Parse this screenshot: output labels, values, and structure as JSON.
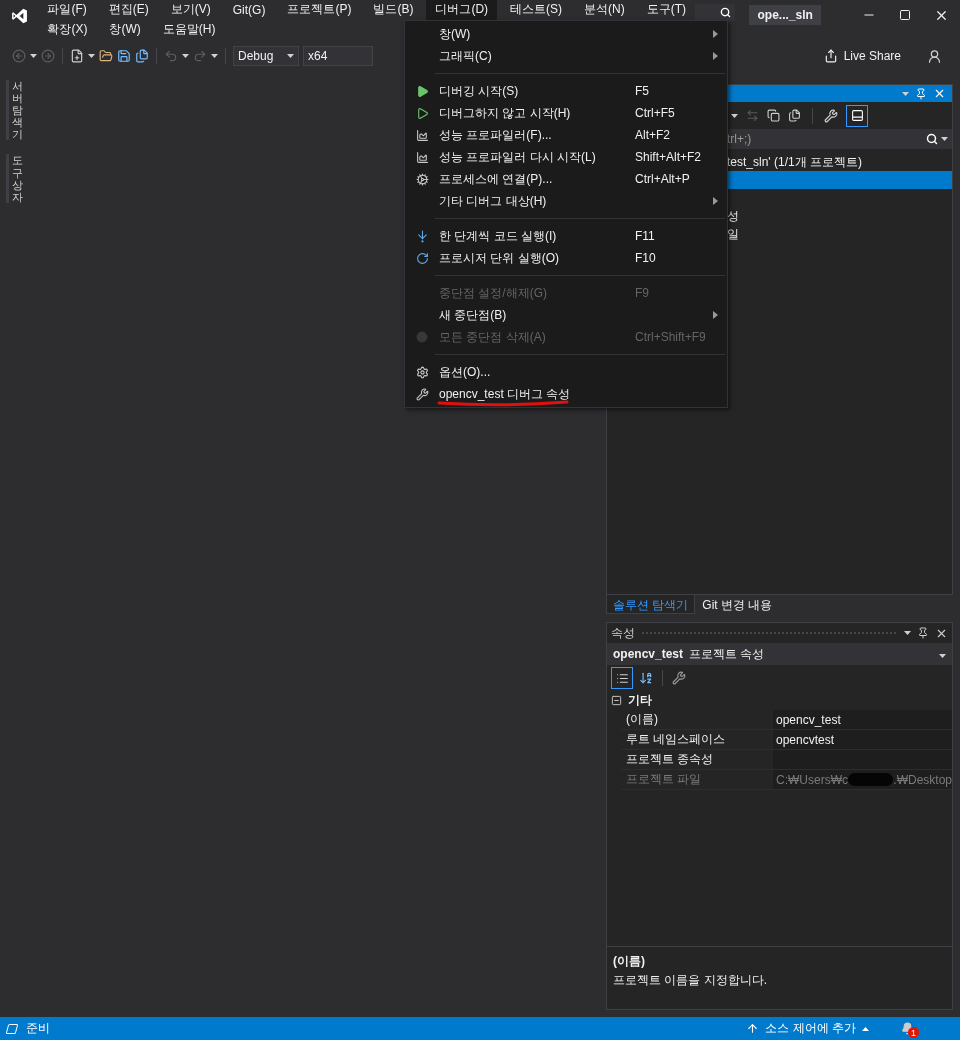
{
  "window": {
    "title": "ope..._sln"
  },
  "menu_rows": [
    [
      {
        "label": "파일(F)",
        "selected": false
      },
      {
        "label": "편집(E)",
        "selected": false
      },
      {
        "label": "보기(V)",
        "selected": false
      },
      {
        "label": "Git(G)",
        "selected": false
      },
      {
        "label": "프로젝트(P)",
        "selected": false
      },
      {
        "label": "빌드(B)",
        "selected": false
      },
      {
        "label": "디버그(D)",
        "selected": true
      },
      {
        "label": "테스트(S)",
        "selected": false
      },
      {
        "label": "분석(N)",
        "selected": false
      },
      {
        "label": "도구(T)",
        "selected": false
      }
    ],
    [
      {
        "label": "확장(X)",
        "selected": false
      },
      {
        "label": "창(W)",
        "selected": false
      },
      {
        "label": "도움말(H)",
        "selected": false
      }
    ]
  ],
  "toolbar": {
    "configuration": "Debug",
    "platform": "x64",
    "live_share": "Live Share"
  },
  "side_tabs": [
    "서버 탐색기",
    "도구 상자"
  ],
  "debug_menu": [
    {
      "kind": "item",
      "label": "창(W)",
      "submenu": true,
      "disabled": false,
      "underlined": false
    },
    {
      "kind": "item",
      "label": "그래픽(C)",
      "submenu": true,
      "disabled": false,
      "underlined": false
    },
    {
      "kind": "separator"
    },
    {
      "kind": "item",
      "label": "디버깅 시작(S)",
      "shortcut": "F5",
      "submenu": false,
      "disabled": false,
      "underlined": false
    },
    {
      "kind": "item",
      "label": "디버그하지 않고 시작(H)",
      "shortcut": "Ctrl+F5",
      "submenu": false,
      "disabled": false,
      "underlined": false
    },
    {
      "kind": "item",
      "label": "성능 프로파일러(F)...",
      "shortcut": "Alt+F2",
      "submenu": false,
      "disabled": false,
      "underlined": false
    },
    {
      "kind": "item",
      "label": "성능 프로파일러 다시 시작(L)",
      "shortcut": "Shift+Alt+F2",
      "submenu": false,
      "disabled": false,
      "underlined": false
    },
    {
      "kind": "item",
      "label": "프로세스에 연결(P)...",
      "shortcut": "Ctrl+Alt+P",
      "submenu": false,
      "disabled": false,
      "underlined": false
    },
    {
      "kind": "item",
      "label": "기타 디버그 대상(H)",
      "submenu": true,
      "disabled": false,
      "underlined": false
    },
    {
      "kind": "separator"
    },
    {
      "kind": "item",
      "label": "한 단계씩 코드 실행(I)",
      "shortcut": "F11",
      "submenu": false,
      "disabled": false,
      "underlined": false
    },
    {
      "kind": "item",
      "label": "프로시저 단위 실행(O)",
      "shortcut": "F10",
      "submenu": false,
      "disabled": false,
      "underlined": false
    },
    {
      "kind": "separator"
    },
    {
      "kind": "item",
      "label": "중단점 설정/해제(G)",
      "shortcut": "F9",
      "submenu": false,
      "disabled": true,
      "underlined": false
    },
    {
      "kind": "item",
      "label": "새 중단점(B)",
      "submenu": true,
      "disabled": false,
      "underlined": false
    },
    {
      "kind": "item",
      "label": "모든 중단점 삭제(A)",
      "shortcut": "Ctrl+Shift+F9",
      "submenu": false,
      "disabled": true,
      "underlined": false
    },
    {
      "kind": "separator"
    },
    {
      "kind": "item",
      "label": "옵션(O)...",
      "submenu": false,
      "disabled": false,
      "underlined": false
    },
    {
      "kind": "item",
      "label": "opencv_test 디버그 속성",
      "submenu": false,
      "disabled": false,
      "underlined": true
    }
  ],
  "solution_explorer": {
    "search": {
      "placeholder": "trl+;)"
    },
    "tree": [
      {
        "label": "test_sln' (1/1개 프로젝트)",
        "selected": false,
        "children": [
          {
            "selected": true
          },
          {
            "selected": false
          },
          {
            "label": "성",
            "selected": false
          },
          {
            "label": "일",
            "selected": false
          }
        ]
      }
    ],
    "tabs": [
      {
        "label": "솔루션 탐색기",
        "selected": true
      },
      {
        "label": "Git 변경 내용",
        "selected": false
      }
    ]
  },
  "properties": {
    "title": "속성",
    "object_name": "opencv_test",
    "object_type": "프로젝트 속성",
    "categories": [
      {
        "label": "기타",
        "expanded": true,
        "rows": [
          {
            "name": "(이름)",
            "value": "opencv_test",
            "disabled": false
          },
          {
            "name": "루트 네임스페이스",
            "value": "opencvtest",
            "disabled": false
          },
          {
            "name": "프로젝트 종속성",
            "disabled": false
          },
          {
            "name": "프로젝트 파일",
            "value": "C:₩Users₩c",
            "value_end": ".₩Desktop",
            "redacted": true,
            "disabled": true
          }
        ]
      }
    ],
    "description": {
      "title": "(이름)",
      "text": "프로젝트 이름을 지정합니다."
    }
  },
  "status_bar": {
    "text": "준비",
    "source_control": "소스 제어에 추가",
    "notifications": "1"
  }
}
